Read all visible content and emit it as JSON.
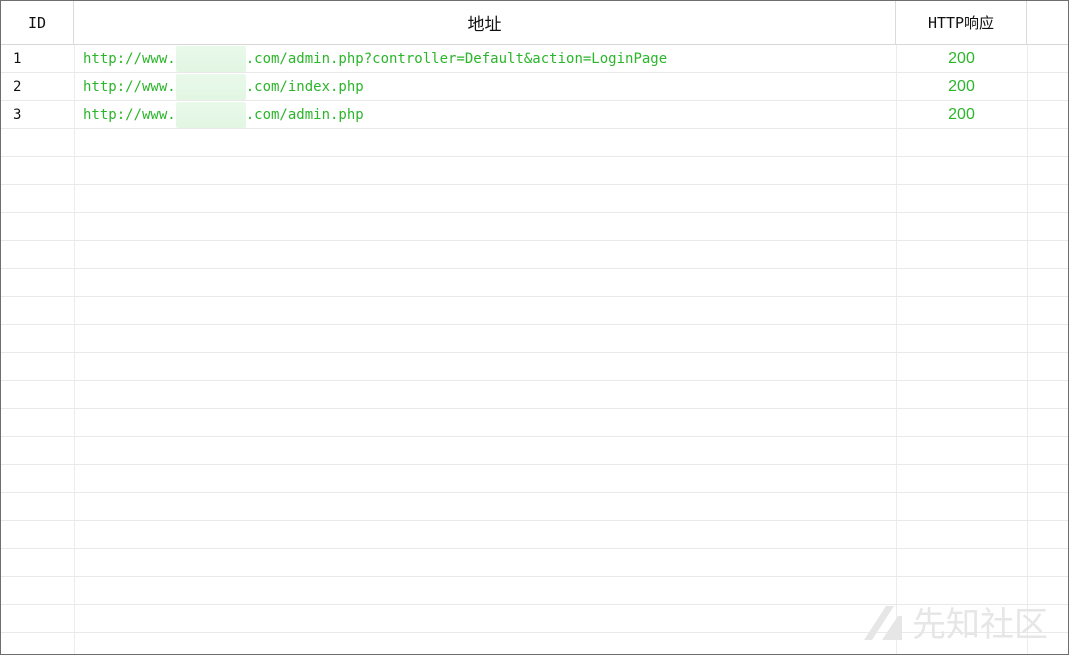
{
  "table": {
    "columns": {
      "id": "ID",
      "address": "地址",
      "http_response": "HTTP响应"
    },
    "rows": [
      {
        "id": "1",
        "url_prefix": "http://www.",
        "url_suffix": ".com/admin.php?controller=Default&action=LoginPage",
        "status": "200"
      },
      {
        "id": "2",
        "url_prefix": "http://www.",
        "url_suffix": ".com/index.php",
        "status": "200"
      },
      {
        "id": "3",
        "url_prefix": "http://www.",
        "url_suffix": ".com/admin.php",
        "status": "200"
      }
    ]
  },
  "watermark": {
    "text": "先知社区",
    "icon": "xianzhi-logo-icon"
  },
  "colors": {
    "url_text": "#2bb52b",
    "status_text": "#2bb52b",
    "grid_line": "#ececec",
    "border": "#6e6e6e",
    "redaction": "#e4f7e5"
  }
}
